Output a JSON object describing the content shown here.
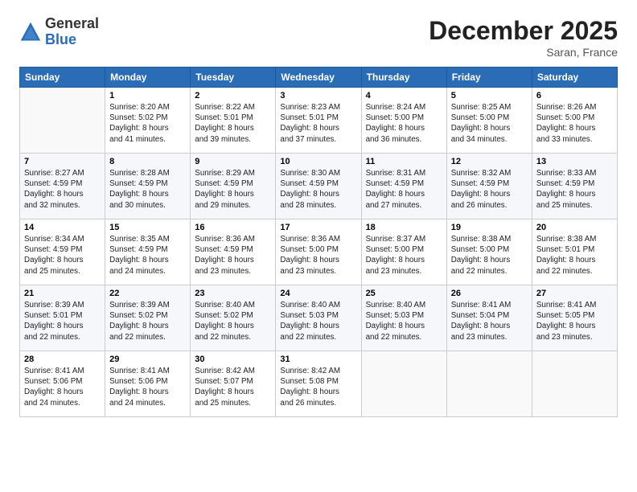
{
  "header": {
    "logo_general": "General",
    "logo_blue": "Blue",
    "month": "December 2025",
    "location": "Saran, France"
  },
  "weekdays": [
    "Sunday",
    "Monday",
    "Tuesday",
    "Wednesday",
    "Thursday",
    "Friday",
    "Saturday"
  ],
  "weeks": [
    [
      {
        "day": "",
        "info": ""
      },
      {
        "day": "1",
        "info": "Sunrise: 8:20 AM\nSunset: 5:02 PM\nDaylight: 8 hours\nand 41 minutes."
      },
      {
        "day": "2",
        "info": "Sunrise: 8:22 AM\nSunset: 5:01 PM\nDaylight: 8 hours\nand 39 minutes."
      },
      {
        "day": "3",
        "info": "Sunrise: 8:23 AM\nSunset: 5:01 PM\nDaylight: 8 hours\nand 37 minutes."
      },
      {
        "day": "4",
        "info": "Sunrise: 8:24 AM\nSunset: 5:00 PM\nDaylight: 8 hours\nand 36 minutes."
      },
      {
        "day": "5",
        "info": "Sunrise: 8:25 AM\nSunset: 5:00 PM\nDaylight: 8 hours\nand 34 minutes."
      },
      {
        "day": "6",
        "info": "Sunrise: 8:26 AM\nSunset: 5:00 PM\nDaylight: 8 hours\nand 33 minutes."
      }
    ],
    [
      {
        "day": "7",
        "info": "Sunrise: 8:27 AM\nSunset: 4:59 PM\nDaylight: 8 hours\nand 32 minutes."
      },
      {
        "day": "8",
        "info": "Sunrise: 8:28 AM\nSunset: 4:59 PM\nDaylight: 8 hours\nand 30 minutes."
      },
      {
        "day": "9",
        "info": "Sunrise: 8:29 AM\nSunset: 4:59 PM\nDaylight: 8 hours\nand 29 minutes."
      },
      {
        "day": "10",
        "info": "Sunrise: 8:30 AM\nSunset: 4:59 PM\nDaylight: 8 hours\nand 28 minutes."
      },
      {
        "day": "11",
        "info": "Sunrise: 8:31 AM\nSunset: 4:59 PM\nDaylight: 8 hours\nand 27 minutes."
      },
      {
        "day": "12",
        "info": "Sunrise: 8:32 AM\nSunset: 4:59 PM\nDaylight: 8 hours\nand 26 minutes."
      },
      {
        "day": "13",
        "info": "Sunrise: 8:33 AM\nSunset: 4:59 PM\nDaylight: 8 hours\nand 25 minutes."
      }
    ],
    [
      {
        "day": "14",
        "info": "Sunrise: 8:34 AM\nSunset: 4:59 PM\nDaylight: 8 hours\nand 25 minutes."
      },
      {
        "day": "15",
        "info": "Sunrise: 8:35 AM\nSunset: 4:59 PM\nDaylight: 8 hours\nand 24 minutes."
      },
      {
        "day": "16",
        "info": "Sunrise: 8:36 AM\nSunset: 4:59 PM\nDaylight: 8 hours\nand 23 minutes."
      },
      {
        "day": "17",
        "info": "Sunrise: 8:36 AM\nSunset: 5:00 PM\nDaylight: 8 hours\nand 23 minutes."
      },
      {
        "day": "18",
        "info": "Sunrise: 8:37 AM\nSunset: 5:00 PM\nDaylight: 8 hours\nand 23 minutes."
      },
      {
        "day": "19",
        "info": "Sunrise: 8:38 AM\nSunset: 5:00 PM\nDaylight: 8 hours\nand 22 minutes."
      },
      {
        "day": "20",
        "info": "Sunrise: 8:38 AM\nSunset: 5:01 PM\nDaylight: 8 hours\nand 22 minutes."
      }
    ],
    [
      {
        "day": "21",
        "info": "Sunrise: 8:39 AM\nSunset: 5:01 PM\nDaylight: 8 hours\nand 22 minutes."
      },
      {
        "day": "22",
        "info": "Sunrise: 8:39 AM\nSunset: 5:02 PM\nDaylight: 8 hours\nand 22 minutes."
      },
      {
        "day": "23",
        "info": "Sunrise: 8:40 AM\nSunset: 5:02 PM\nDaylight: 8 hours\nand 22 minutes."
      },
      {
        "day": "24",
        "info": "Sunrise: 8:40 AM\nSunset: 5:03 PM\nDaylight: 8 hours\nand 22 minutes."
      },
      {
        "day": "25",
        "info": "Sunrise: 8:40 AM\nSunset: 5:03 PM\nDaylight: 8 hours\nand 22 minutes."
      },
      {
        "day": "26",
        "info": "Sunrise: 8:41 AM\nSunset: 5:04 PM\nDaylight: 8 hours\nand 23 minutes."
      },
      {
        "day": "27",
        "info": "Sunrise: 8:41 AM\nSunset: 5:05 PM\nDaylight: 8 hours\nand 23 minutes."
      }
    ],
    [
      {
        "day": "28",
        "info": "Sunrise: 8:41 AM\nSunset: 5:06 PM\nDaylight: 8 hours\nand 24 minutes."
      },
      {
        "day": "29",
        "info": "Sunrise: 8:41 AM\nSunset: 5:06 PM\nDaylight: 8 hours\nand 24 minutes."
      },
      {
        "day": "30",
        "info": "Sunrise: 8:42 AM\nSunset: 5:07 PM\nDaylight: 8 hours\nand 25 minutes."
      },
      {
        "day": "31",
        "info": "Sunrise: 8:42 AM\nSunset: 5:08 PM\nDaylight: 8 hours\nand 26 minutes."
      },
      {
        "day": "",
        "info": ""
      },
      {
        "day": "",
        "info": ""
      },
      {
        "day": "",
        "info": ""
      }
    ]
  ]
}
